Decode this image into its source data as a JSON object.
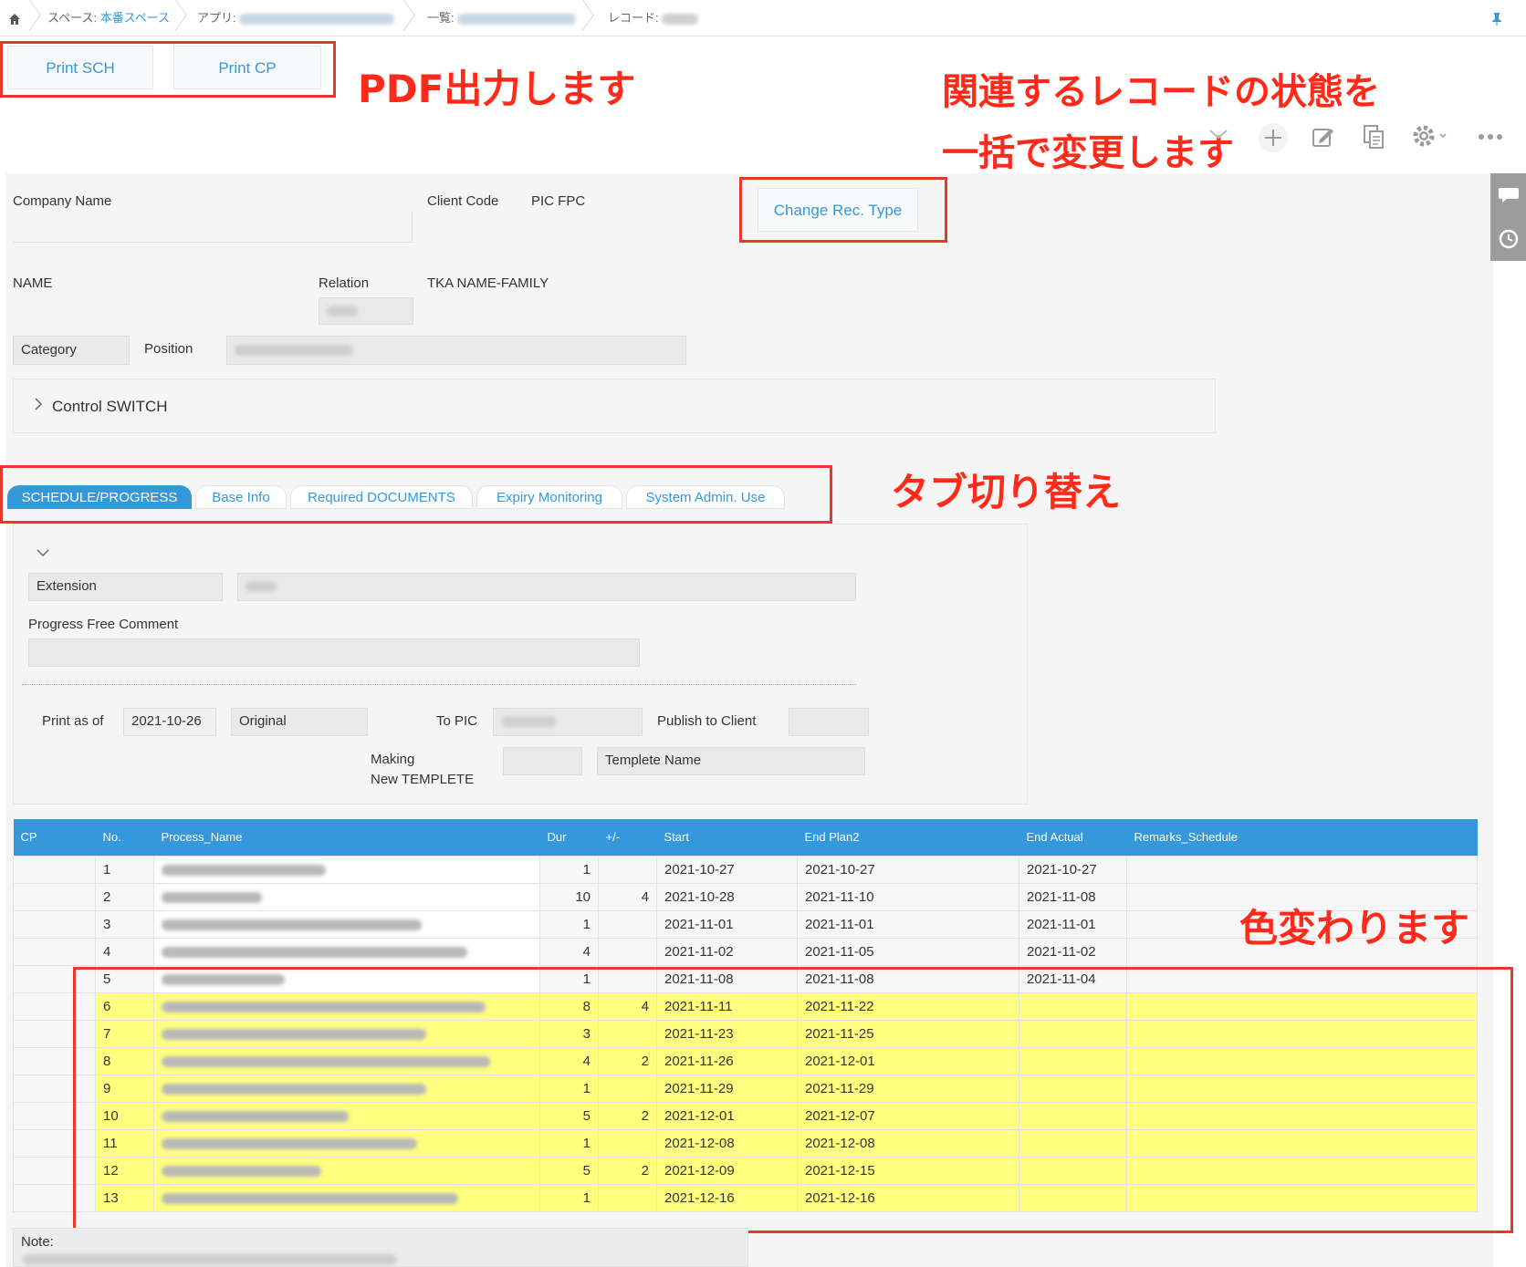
{
  "breadcrumb": {
    "space_label": "スペース:",
    "space_name": "本番スペース",
    "app_label": "アプリ:",
    "view_label": "一覧:",
    "record_label": "レコード:"
  },
  "actions": {
    "print_sch": "Print SCH",
    "print_cp": "Print CP",
    "change_rec_type": "Change Rec. Type"
  },
  "annotations": {
    "pdf": "PDF出力します",
    "bulk_line1": "関連するレコードの状態を",
    "bulk_line2": "一括で変更します",
    "tabs": "タブ切り替え",
    "color": "色変わります"
  },
  "fields": {
    "company_name": "Company  Name",
    "client_code": "Client Code",
    "pic_fpc": "PIC  FPC",
    "name": "NAME",
    "relation": "Relation",
    "tka_name_family": "TKA NAME-FAMILY",
    "category": "Category",
    "position": "Position",
    "control_switch": "Control SWITCH"
  },
  "tabs": [
    "SCHEDULE/PROGRESS",
    "Base Info",
    "Required DOCUMENTS",
    "Expiry Monitoring",
    "System Admin. Use"
  ],
  "schedule": {
    "extension": "Extension",
    "progress_free_comment": "Progress Free Comment",
    "print_as_of": "Print as of",
    "print_as_of_value": "2021-10-26",
    "original": "Original",
    "to_pic": "To PIC",
    "publish_to_client": "Publish to Client",
    "making_line1": "Making",
    "making_line2": "New TEMPLETE",
    "templete_name": "Templete Name"
  },
  "table": {
    "headers": [
      "CP",
      "No.",
      "Process_Name",
      "Dur",
      "+/-",
      "Start",
      "End Plan2",
      "End Actual",
      "Remarks_Schedule"
    ],
    "rows": [
      {
        "no": "1",
        "dur": "1",
        "pm": "",
        "start": "2021-10-27",
        "end_plan": "2021-10-27",
        "end_actual": "2021-10-27",
        "highlight": false
      },
      {
        "no": "2",
        "dur": "10",
        "pm": "4",
        "start": "2021-10-28",
        "end_plan": "2021-11-10",
        "end_actual": "2021-11-08",
        "highlight": false
      },
      {
        "no": "3",
        "dur": "1",
        "pm": "",
        "start": "2021-11-01",
        "end_plan": "2021-11-01",
        "end_actual": "2021-11-01",
        "highlight": false
      },
      {
        "no": "4",
        "dur": "4",
        "pm": "",
        "start": "2021-11-02",
        "end_plan": "2021-11-05",
        "end_actual": "2021-11-02",
        "highlight": false
      },
      {
        "no": "5",
        "dur": "1",
        "pm": "",
        "start": "2021-11-08",
        "end_plan": "2021-11-08",
        "end_actual": "2021-11-04",
        "highlight": false
      },
      {
        "no": "6",
        "dur": "8",
        "pm": "4",
        "start": "2021-11-11",
        "end_plan": "2021-11-22",
        "end_actual": "",
        "highlight": true
      },
      {
        "no": "7",
        "dur": "3",
        "pm": "",
        "start": "2021-11-23",
        "end_plan": "2021-11-25",
        "end_actual": "",
        "highlight": true
      },
      {
        "no": "8",
        "dur": "4",
        "pm": "2",
        "start": "2021-11-26",
        "end_plan": "2021-12-01",
        "end_actual": "",
        "highlight": true
      },
      {
        "no": "9",
        "dur": "1",
        "pm": "",
        "start": "2021-11-29",
        "end_plan": "2021-11-29",
        "end_actual": "",
        "highlight": true
      },
      {
        "no": "10",
        "dur": "5",
        "pm": "2",
        "start": "2021-12-01",
        "end_plan": "2021-12-07",
        "end_actual": "",
        "highlight": true
      },
      {
        "no": "11",
        "dur": "1",
        "pm": "",
        "start": "2021-12-08",
        "end_plan": "2021-12-08",
        "end_actual": "",
        "highlight": true
      },
      {
        "no": "12",
        "dur": "5",
        "pm": "2",
        "start": "2021-12-09",
        "end_plan": "2021-12-15",
        "end_actual": "",
        "highlight": true
      },
      {
        "no": "13",
        "dur": "1",
        "pm": "",
        "start": "2021-12-16",
        "end_plan": "2021-12-16",
        "end_actual": "",
        "highlight": true
      }
    ]
  },
  "note_label": "Note:",
  "colors": {
    "accent": "#3498db",
    "annotation": "#ff2a1a",
    "highlight_row": "#ffff80"
  }
}
